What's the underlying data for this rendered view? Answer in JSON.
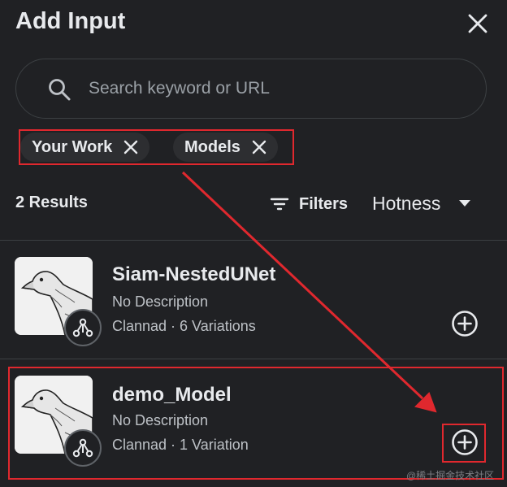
{
  "header": {
    "title": "Add Input"
  },
  "search": {
    "placeholder": "Search keyword or URL"
  },
  "chips": [
    {
      "label": "Your Work"
    },
    {
      "label": "Models"
    }
  ],
  "results": {
    "count_label": "2 Results",
    "filters_label": "Filters",
    "sort_label": "Hotness"
  },
  "items": [
    {
      "name": "Siam-NestedUNet",
      "description": "No Description",
      "meta": "Clannad · 6 Variations"
    },
    {
      "name": "demo_Model",
      "description": "No Description",
      "meta": "Clannad · 1 Variation"
    }
  ],
  "annotation": {
    "color": "#e0282e"
  },
  "watermark": "@稀土掘金技术社区"
}
